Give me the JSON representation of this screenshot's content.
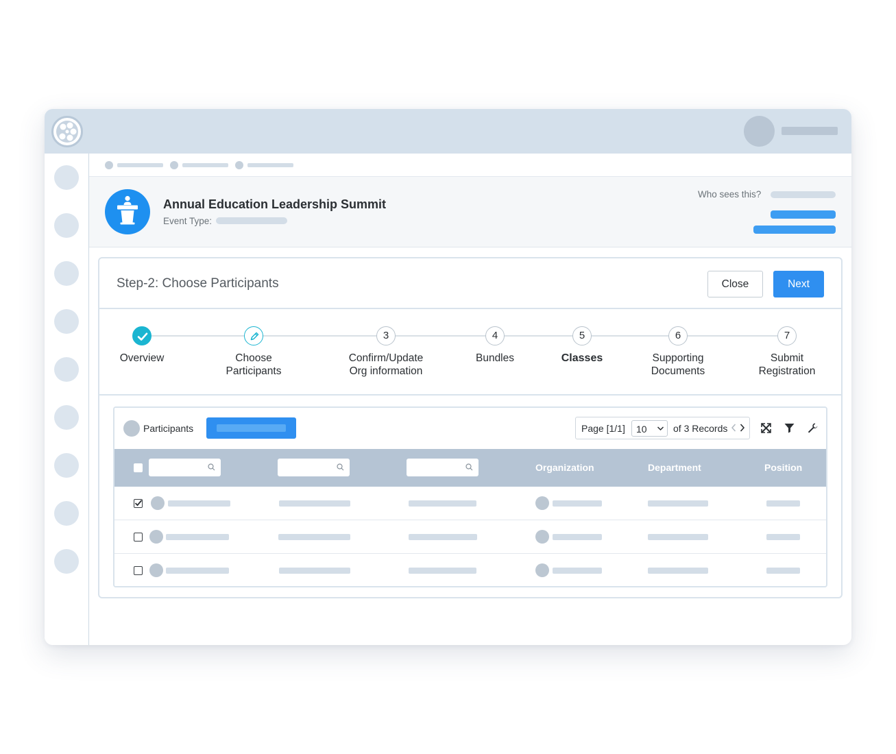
{
  "app": {
    "logo_icon": "film-reel-icon"
  },
  "header": {
    "event_title": "Annual Education Leadership Summit",
    "event_type_label": "Event Type:",
    "event_icon": "podium-speaker-icon",
    "who_sees_label": "Who sees this?"
  },
  "step": {
    "title": "Step-2: Choose Participants",
    "close_label": "Close",
    "next_label": "Next"
  },
  "stepper": {
    "steps": [
      {
        "number": "",
        "label_lines": [
          "Overview"
        ],
        "state": "complete"
      },
      {
        "number": "",
        "label_lines": [
          "Choose",
          "Participants"
        ],
        "state": "current"
      },
      {
        "number": "3",
        "label_lines": [
          "Confirm/Update",
          "Org information"
        ],
        "state": "upcoming"
      },
      {
        "number": "4",
        "label_lines": [
          "Bundles"
        ],
        "state": "upcoming"
      },
      {
        "number": "5",
        "label_lines": [
          "Classes"
        ],
        "state": "upcoming"
      },
      {
        "number": "6",
        "label_lines": [
          "Supporting",
          "Documents"
        ],
        "state": "upcoming"
      },
      {
        "number": "7",
        "label_lines": [
          "Submit",
          "Registration"
        ],
        "state": "upcoming"
      }
    ]
  },
  "participants": {
    "label": "Participants",
    "page_text": "Page [1/1]",
    "page_size": "10",
    "records_text": "of 3 Records",
    "columns": [
      "Organization",
      "Department",
      "Position"
    ],
    "rows": [
      {
        "checked": true
      },
      {
        "checked": false
      },
      {
        "checked": false
      }
    ]
  },
  "colors": {
    "accent": "#2f8ff0",
    "step_complete": "#1bb5d1",
    "table_header": "#b5c4d4",
    "topbar": "#d4e0eb"
  }
}
